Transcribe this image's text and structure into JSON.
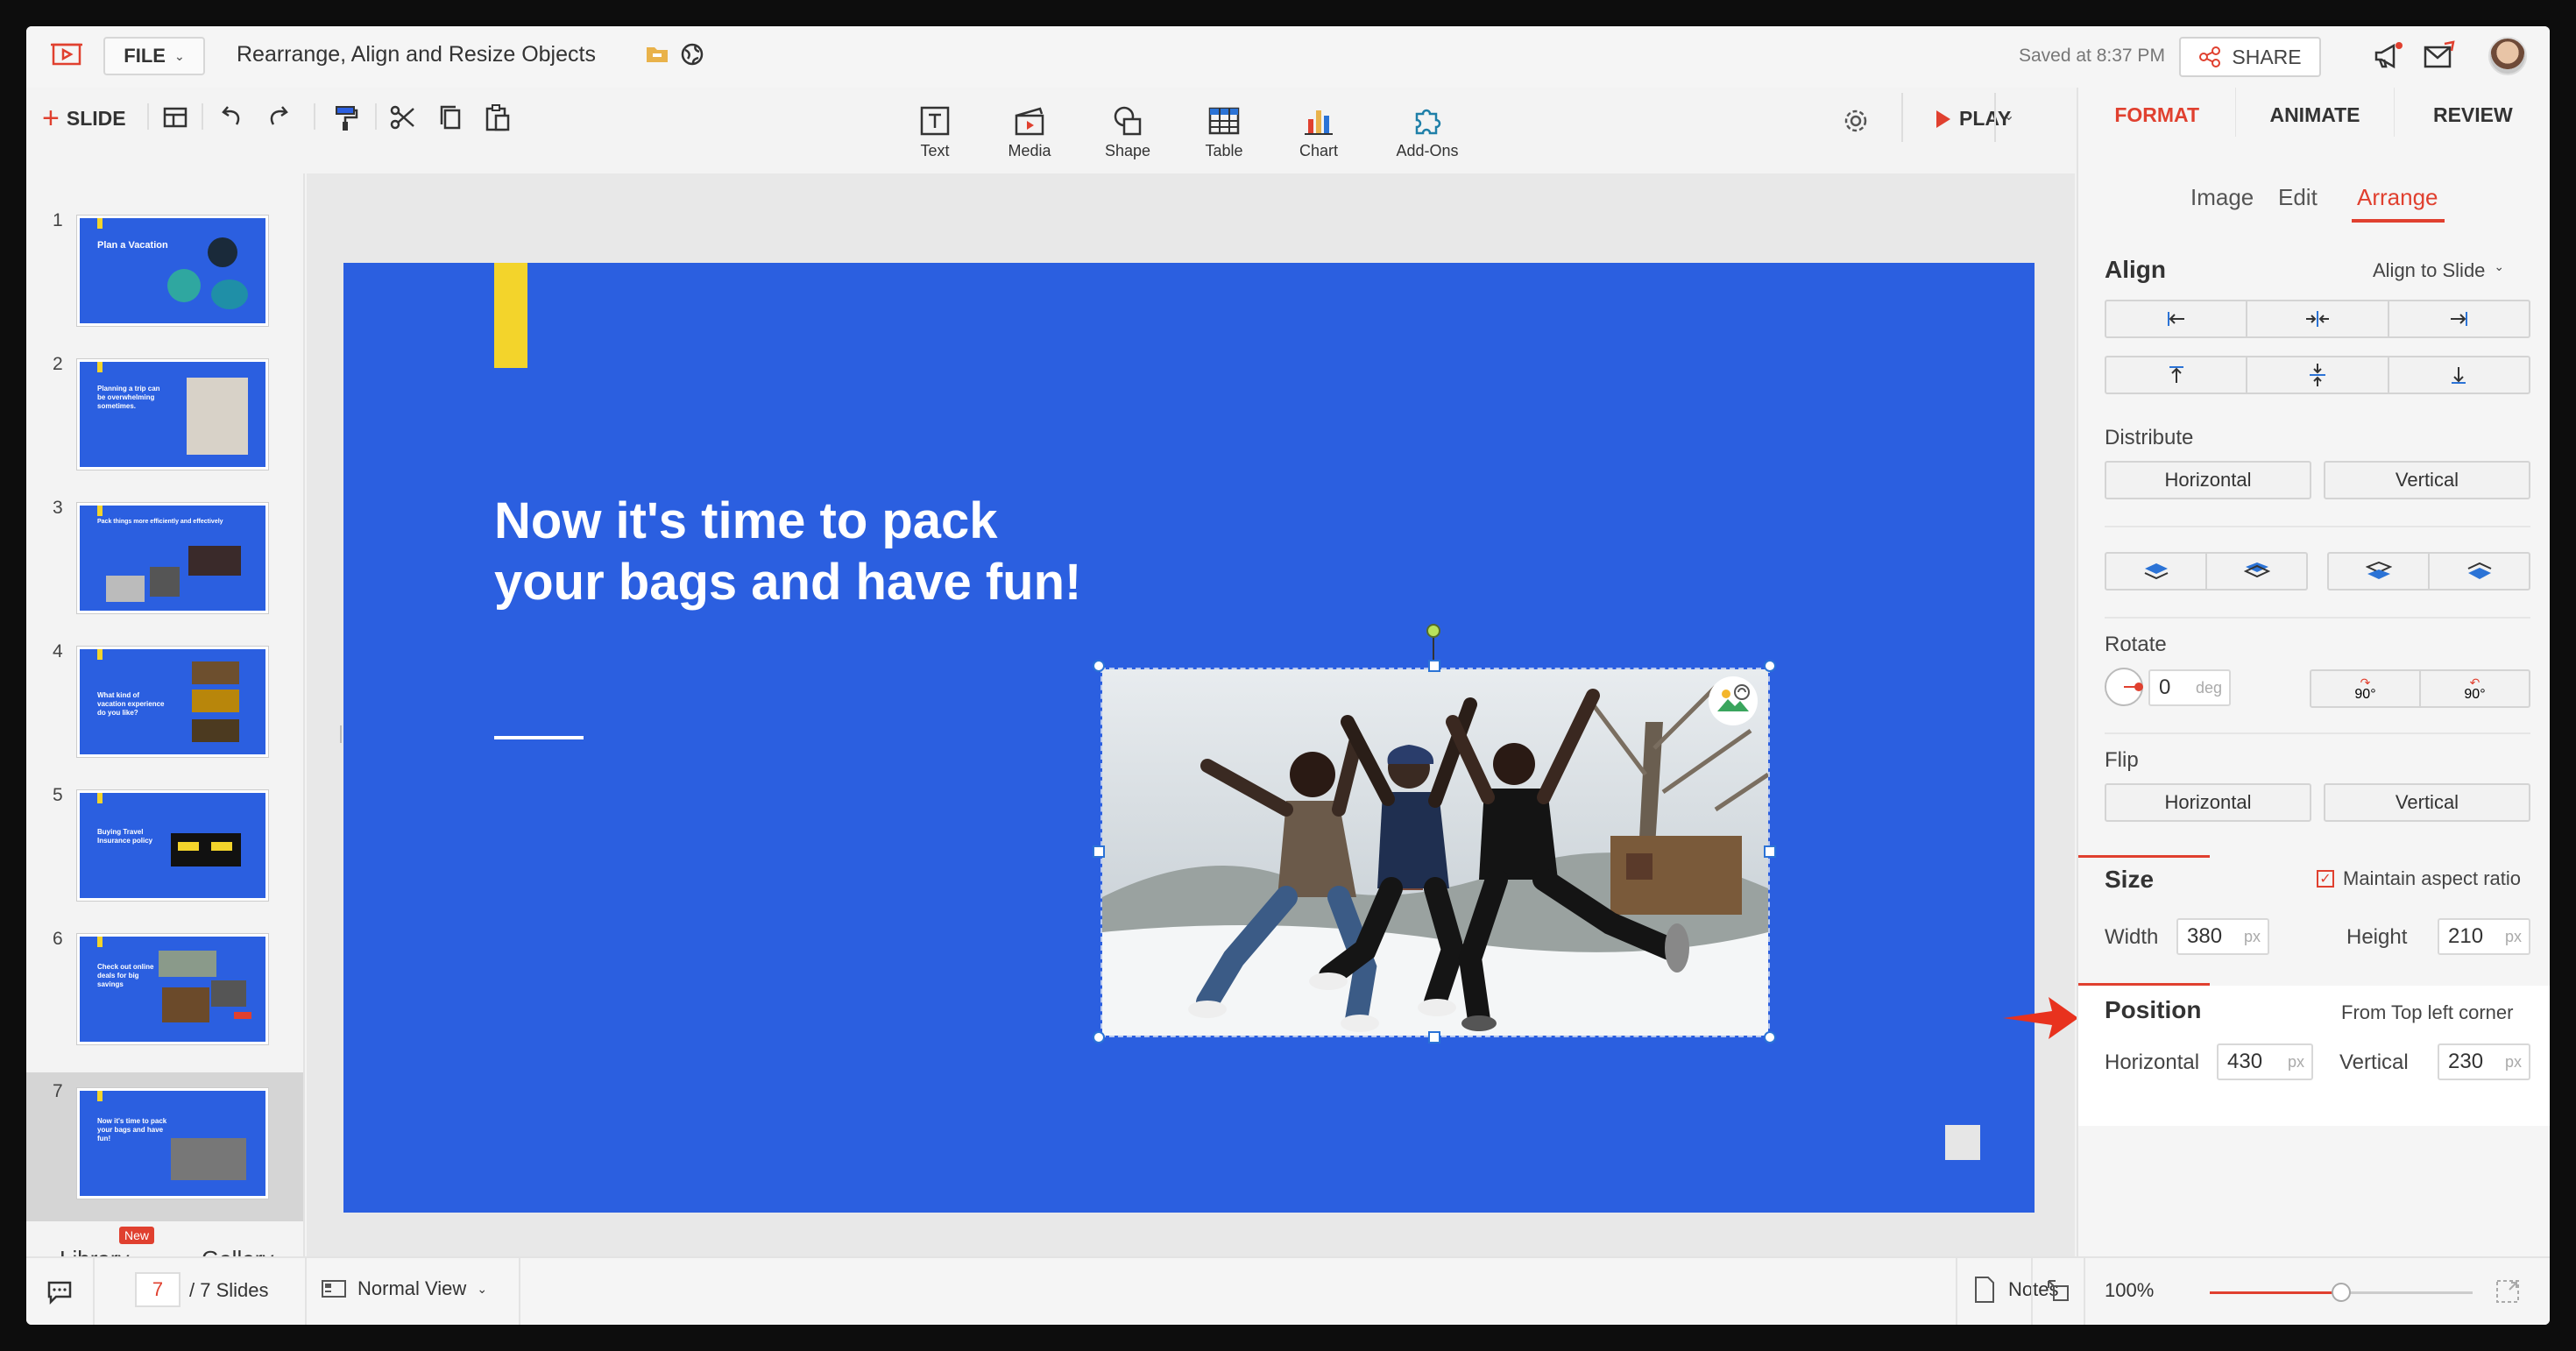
{
  "app": {
    "document_title": "Rearrange, Align and Resize Objects",
    "file_label": "FILE",
    "saved_text": "Saved at 8:37 PM",
    "share_label": "SHARE"
  },
  "toolbar": {
    "slide_label": "SLIDE",
    "play_label": "PLAY",
    "insert_items": [
      {
        "label": "Text",
        "icon": "text-box-icon"
      },
      {
        "label": "Media",
        "icon": "media-clapper-icon"
      },
      {
        "label": "Shape",
        "icon": "shape-icon"
      },
      {
        "label": "Table",
        "icon": "table-icon"
      },
      {
        "label": "Chart",
        "icon": "bar-chart-icon"
      },
      {
        "label": "Add-Ons",
        "icon": "puzzle-icon"
      }
    ]
  },
  "right_panel": {
    "tabs": [
      "FORMAT",
      "ANIMATE",
      "REVIEW"
    ],
    "active_tab": "FORMAT",
    "subtabs": [
      "Image",
      "Edit",
      "Arrange"
    ],
    "active_subtab": "Arrange",
    "align": {
      "heading": "Align",
      "target": "Align to Slide"
    },
    "distribute": {
      "heading": "Distribute",
      "horizontal": "Horizontal",
      "vertical": "Vertical"
    },
    "rotate": {
      "heading": "Rotate",
      "value": "0",
      "unit": "deg",
      "cw_label": "90°",
      "ccw_label": "90°"
    },
    "flip": {
      "heading": "Flip",
      "horizontal": "Horizontal",
      "vertical": "Vertical"
    },
    "size": {
      "heading": "Size",
      "aspect_label": "Maintain aspect ratio",
      "aspect_checked": true,
      "width_label": "Width",
      "width_value": "380",
      "height_label": "Height",
      "height_value": "210",
      "unit": "px"
    },
    "position": {
      "heading": "Position",
      "reference": "From Top left corner",
      "horizontal_label": "Horizontal",
      "horizontal_value": "430",
      "vertical_label": "Vertical",
      "vertical_value": "230",
      "unit": "px"
    }
  },
  "slides_panel": {
    "thumbnails": [
      {
        "number": "1",
        "title": "Plan a Vacation"
      },
      {
        "number": "2",
        "title": "Planning a trip can be overwhelming sometimes."
      },
      {
        "number": "3",
        "title": "Pack things more efficiently and effectively"
      },
      {
        "number": "4",
        "title": "What kind of vacation experience do you like?"
      },
      {
        "number": "5",
        "title": "Buying Travel Insurance policy"
      },
      {
        "number": "6",
        "title": "Check out online deals for big savings"
      },
      {
        "number": "7",
        "title": "Now it's time to pack your bags and have fun!"
      }
    ],
    "selected": "7",
    "library_label": "Library",
    "library_badge": "New",
    "gallery_label": "Gallery"
  },
  "slide": {
    "title": "Now it's time to pack your bags and have fun!"
  },
  "status_bar": {
    "current_slide": "7",
    "total_slides": "/ 7 Slides",
    "view_label": "Normal View",
    "notes_label": "Notes",
    "zoom": "100%",
    "zoom_fraction": 0.5
  },
  "colors": {
    "accent": "#e0402f",
    "slide_bg": "#2b5fe0",
    "slide_accent_bar": "#f3d42b"
  }
}
